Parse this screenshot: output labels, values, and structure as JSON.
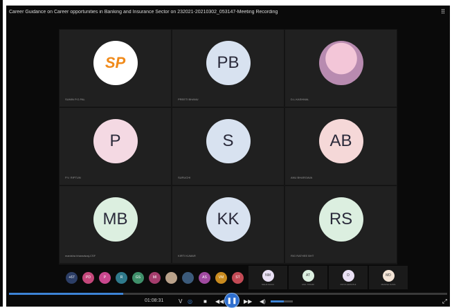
{
  "window": {
    "title": "Career Guidance on Career opportunities in Banking and Insurance Sector on 232021-20210302_053147-Meeting Recording"
  },
  "tiles": [
    {
      "initials": "SP",
      "name": "SUMIN P.G.PAL",
      "kind": "logo",
      "bg": "#ffffff"
    },
    {
      "initials": "PB",
      "name": "PREETI BHANU",
      "kind": "initials",
      "bg": "#d8e2f0"
    },
    {
      "initials": "",
      "name": "D.L.KASHMAL",
      "kind": "photo",
      "bg": "#f3c6d8"
    },
    {
      "initials": "P",
      "name": "P.V. RIPTUN",
      "kind": "initials",
      "bg": "#f4d9e3"
    },
    {
      "initials": "S",
      "name": "SURUCHI",
      "kind": "initials",
      "bg": "#d8e2f0"
    },
    {
      "initials": "AB",
      "name": "ANU BHARGAVA",
      "kind": "initials",
      "bg": "#f5d8d8"
    },
    {
      "initials": "MB",
      "name": "manisha bharadwaj-CSF",
      "kind": "initials",
      "bg": "#dcefe0"
    },
    {
      "initials": "KK",
      "name": "KIRTI KUMAR",
      "kind": "initials",
      "bg": "#d8e2f0"
    },
    {
      "initials": "RS",
      "name": "RIG RATHEE BHT",
      "kind": "initials",
      "bg": "#dcefe0"
    }
  ],
  "strip": {
    "overflow": "+67",
    "chips": [
      {
        "label": "PD",
        "color": "#c4477a"
      },
      {
        "label": "P",
        "color": "#c9478e"
      },
      {
        "label": "R",
        "color": "#2f7a8c"
      },
      {
        "label": "GS",
        "color": "#3f8f6a"
      },
      {
        "label": "MI",
        "color": "#a53d6d"
      },
      {
        "label": "",
        "color": "#b9a18a"
      },
      {
        "label": "",
        "color": "#3b5a7a"
      },
      {
        "label": "AS",
        "color": "#a04aa0"
      },
      {
        "label": "VM",
        "color": "#c98b1f"
      },
      {
        "label": "ST",
        "color": "#c24a55"
      }
    ],
    "minis": [
      {
        "label": "NM",
        "color": "#e9e0f4",
        "name": "NEHA MAAN"
      },
      {
        "label": "AT",
        "color": "#dcefe0",
        "name": "ANIL TIWARI"
      },
      {
        "label": "D",
        "color": "#e9e0f4",
        "name": "DIVYA AWASTHI"
      },
      {
        "label": "MD",
        "color": "#f3e4d6",
        "name": "MANISH DASS"
      }
    ]
  },
  "player": {
    "time": "01:08:31",
    "progress": 0.26,
    "volume": 0.6
  }
}
